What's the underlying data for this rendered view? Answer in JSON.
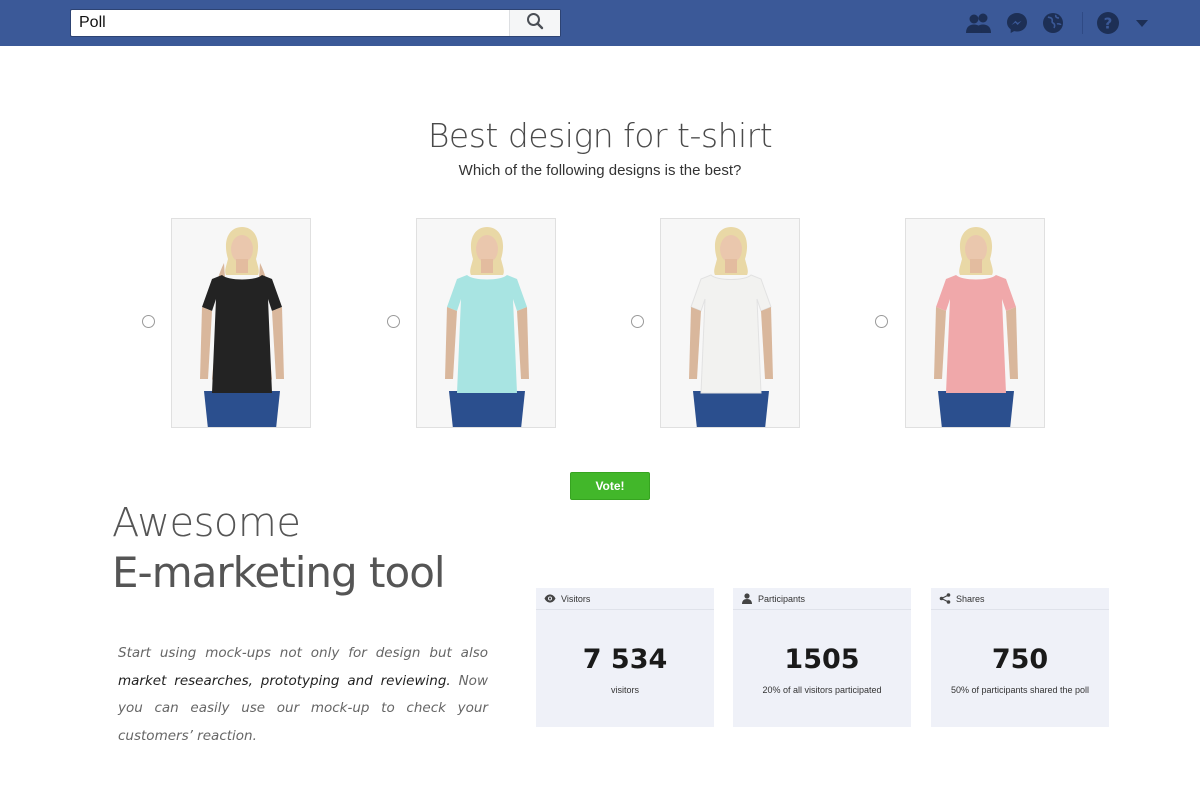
{
  "search": {
    "value": "Poll"
  },
  "poll": {
    "title": "Best design for t-shirt",
    "subtitle": "Which of the following designs is the best?",
    "options": [
      {
        "shirt_color": "#232323"
      },
      {
        "shirt_color": "#a8e4e2"
      },
      {
        "shirt_color": "#f2f2f0"
      },
      {
        "shirt_color": "#f0a8aa"
      }
    ],
    "vote_label": "Vote!"
  },
  "promo": {
    "line1": "Awesome",
    "line2": "E-marketing tool",
    "desc_part1": "Start using mock-ups not only for design but also ",
    "desc_bold": "market researches, prototyping and reviewing.",
    "desc_part2": " Now you can easily use our mock-up to check your customers’ reaction."
  },
  "stats": [
    {
      "label": "Visitors",
      "icon": "eye-icon",
      "value": "7 534",
      "note": "visitors"
    },
    {
      "label": "Participants",
      "icon": "person-icon",
      "value": "1505",
      "note": "20% of all visitors participated"
    },
    {
      "label": "Shares",
      "icon": "share-icon",
      "value": "750",
      "note": "50% of participants shared the poll"
    }
  ],
  "colors": {
    "topbar": "#3b5998",
    "vote_button": "#42b72a",
    "stat_card": "#eff1f8"
  }
}
